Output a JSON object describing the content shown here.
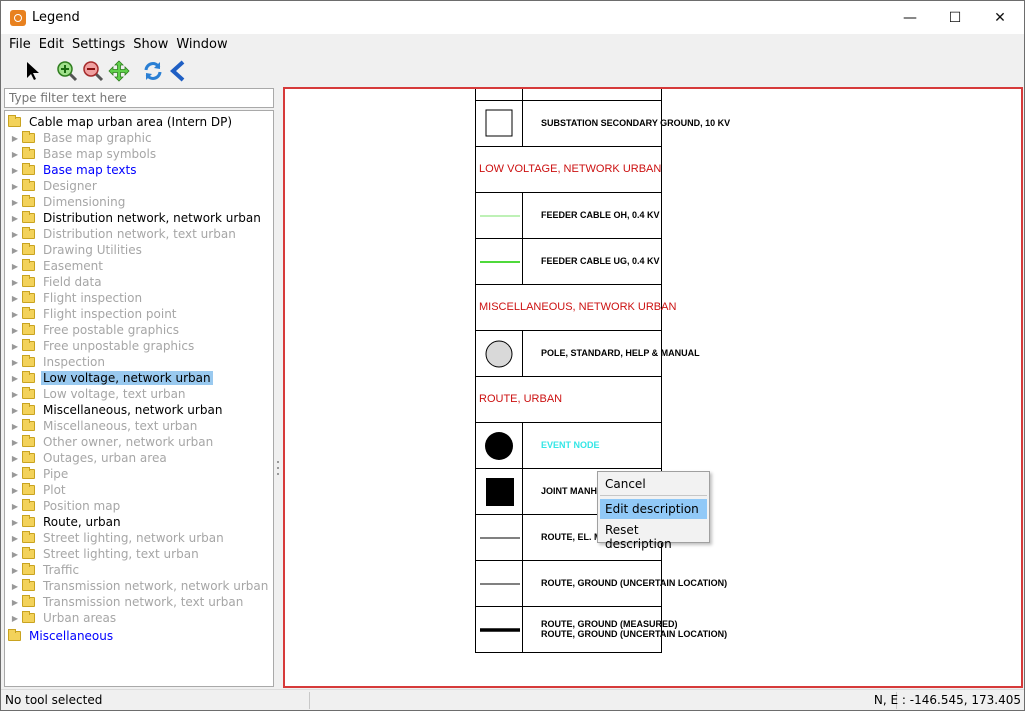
{
  "window": {
    "title": "Legend",
    "minimize_glyph": "—",
    "maximize_glyph": "☐",
    "close_glyph": "✕"
  },
  "menu": [
    {
      "label": "File"
    },
    {
      "label": "Edit"
    },
    {
      "label": "Settings"
    },
    {
      "label": "Show"
    },
    {
      "label": "Window"
    }
  ],
  "toolbar": [
    {
      "icon": "pointer-icon"
    },
    {
      "icon": "zoom-in-icon"
    },
    {
      "icon": "zoom-out-icon"
    },
    {
      "icon": "pan-icon"
    },
    {
      "icon": "refresh-icon"
    },
    {
      "icon": "back-icon"
    }
  ],
  "filter": {
    "placeholder": "Type filter text here"
  },
  "tree": {
    "root": "Cable map urban area (Intern DP)",
    "items": [
      {
        "label": "Base map graphic",
        "style": "gray"
      },
      {
        "label": "Base map symbols",
        "style": "gray"
      },
      {
        "label": "Base map texts",
        "style": "blue"
      },
      {
        "label": "Designer",
        "style": "gray"
      },
      {
        "label": "Dimensioning",
        "style": "gray"
      },
      {
        "label": "Distribution network, network urban",
        "style": "black"
      },
      {
        "label": "Distribution network, text urban",
        "style": "gray"
      },
      {
        "label": "Drawing Utilities",
        "style": "gray"
      },
      {
        "label": "Easement",
        "style": "gray"
      },
      {
        "label": "Field data",
        "style": "gray"
      },
      {
        "label": "Flight inspection",
        "style": "gray"
      },
      {
        "label": "Flight inspection point",
        "style": "gray"
      },
      {
        "label": "Free postable graphics",
        "style": "gray"
      },
      {
        "label": "Free unpostable graphics",
        "style": "gray"
      },
      {
        "label": "Inspection",
        "style": "gray"
      },
      {
        "label": "Low voltage, network urban",
        "style": "selected"
      },
      {
        "label": "Low voltage, text urban",
        "style": "gray"
      },
      {
        "label": "Miscellaneous, network urban",
        "style": "black"
      },
      {
        "label": "Miscellaneous, text urban",
        "style": "gray"
      },
      {
        "label": "Other owner, network urban",
        "style": "gray"
      },
      {
        "label": "Outages, urban area",
        "style": "gray"
      },
      {
        "label": "Pipe",
        "style": "gray"
      },
      {
        "label": "Plot",
        "style": "gray"
      },
      {
        "label": "Position map",
        "style": "gray"
      },
      {
        "label": "Route, urban",
        "style": "black"
      },
      {
        "label": "Street lighting, network urban",
        "style": "gray"
      },
      {
        "label": "Street lighting, text urban",
        "style": "gray"
      },
      {
        "label": "Traffic",
        "style": "gray"
      },
      {
        "label": "Transmission network, network urban",
        "style": "gray"
      },
      {
        "label": "Transmission network, text urban",
        "style": "gray"
      },
      {
        "label": "Urban areas",
        "style": "gray"
      }
    ],
    "trailing_root": "Miscellaneous"
  },
  "legend": {
    "rows": [
      {
        "kind": "symbol",
        "symbol": "empty",
        "text": ""
      },
      {
        "kind": "symbol",
        "symbol": "square-outline",
        "text": "SUBSTATION SECONDARY GROUND, 10 KV"
      },
      {
        "kind": "header",
        "text": "LOW VOLTAGE, NETWORK URBAN"
      },
      {
        "kind": "symbol",
        "symbol": "line-green-thin",
        "text": "FEEDER CABLE OH, 0.4 KV"
      },
      {
        "kind": "symbol",
        "symbol": "line-green",
        "text": "FEEDER CABLE UG, 0.4 KV"
      },
      {
        "kind": "header",
        "text": "MISCELLANEOUS, NETWORK URBAN"
      },
      {
        "kind": "symbol",
        "symbol": "circle-gray",
        "text": "POLE, STANDARD, HELP & MANUAL"
      },
      {
        "kind": "header",
        "text": "ROUTE, URBAN"
      },
      {
        "kind": "symbol",
        "symbol": "circle-black",
        "text": "EVENT NODE",
        "text_color": "#33e6e6"
      },
      {
        "kind": "symbol",
        "symbol": "square-black",
        "text": "JOINT MANHOLE"
      },
      {
        "kind": "symbol",
        "symbol": "line-black-thin",
        "text": "ROUTE, EL. MEASURED POS"
      },
      {
        "kind": "symbol",
        "symbol": "line-black-thin",
        "text": "ROUTE, GROUND  (UNCERTAIN LOCATION)"
      },
      {
        "kind": "symbol",
        "symbol": "line-black-thick",
        "text": "ROUTE, GROUND (MEASURED)",
        "text2": "ROUTE, GROUND  (UNCERTAIN LOCATION)"
      }
    ]
  },
  "context_menu": {
    "items": [
      {
        "label": "Cancel"
      },
      {
        "label": "Edit description",
        "highlighted": true
      },
      {
        "label": "Reset description"
      }
    ]
  },
  "status": {
    "left": "No tool selected",
    "right": "N, E : -146.545, 173.405"
  },
  "colors": {
    "header_red": "#cc1111",
    "selection": "#99c9ef",
    "canvas_border": "#d63a3a",
    "event_node_cyan": "#33e6e6"
  }
}
